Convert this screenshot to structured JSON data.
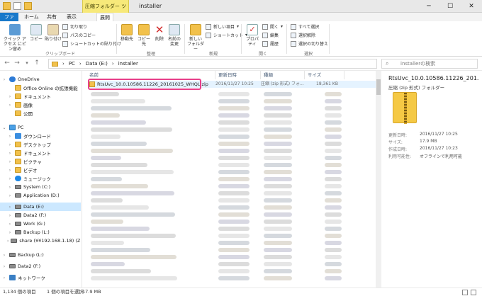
{
  "window": {
    "context_tab": "圧縮フォルダー ツール",
    "title": "installer",
    "minimize": "─",
    "maximize": "☐",
    "close": "✕"
  },
  "ribbon_tabs": [
    "ファイル",
    "ホーム",
    "共有",
    "表示",
    "展開"
  ],
  "ribbon": {
    "pin_label": "クイック アクセス にピン留め",
    "copy_label": "コピー",
    "paste_label": "貼り付け",
    "cut_label": "切り取り",
    "copy_path_label": "パスのコピー",
    "paste_shortcut_label": "ショートカットの貼り付け",
    "clipboard_group": "クリップボード",
    "move_to_label": "移動先",
    "copy_to_label": "コピー先",
    "delete_label": "削除",
    "rename_label": "名前の変更",
    "organize_group": "整理",
    "new_folder_label": "新しい フォルダー",
    "new_item_label": "新しい項目",
    "shortcut_label": "ショートカット",
    "new_group": "新規",
    "properties_label": "プロパティ",
    "open_label": "開く",
    "edit_label": "編集",
    "history_label": "履歴",
    "open_group": "開く",
    "select_all_label": "すべて選択",
    "select_none_label": "選択解除",
    "invert_selection_label": "選択の切り替え",
    "select_group": "選択"
  },
  "address": {
    "breadcrumb": [
      "PC",
      "Data (E:)",
      "installer"
    ],
    "search_placeholder": "installerの検索"
  },
  "nav_items": [
    {
      "label": "OneDrive",
      "icon": "onedrive-icon",
      "level": 0,
      "chev": "›"
    },
    {
      "label": "Office Online の拡張機能",
      "icon": "folder-icon",
      "level": 1,
      "chev": ""
    },
    {
      "label": "ドキュメント",
      "icon": "folder-icon",
      "level": 1,
      "chev": "›"
    },
    {
      "label": "画像",
      "icon": "folder-icon",
      "level": 1,
      "chev": "›"
    },
    {
      "label": "公開",
      "icon": "folder-icon",
      "level": 1,
      "chev": ""
    },
    {
      "label": "PC",
      "icon": "pc-icon",
      "level": 0,
      "chev": "⌄"
    },
    {
      "label": "ダウンロード",
      "icon": "download-icon",
      "level": 1,
      "chev": "›"
    },
    {
      "label": "デスクトップ",
      "icon": "folder-icon",
      "level": 1,
      "chev": "›"
    },
    {
      "label": "ドキュメント",
      "icon": "folder-icon",
      "level": 1,
      "chev": "›"
    },
    {
      "label": "ピクチャ",
      "icon": "folder-icon",
      "level": 1,
      "chev": "›"
    },
    {
      "label": "ビデオ",
      "icon": "folder-icon",
      "level": 1,
      "chev": "›"
    },
    {
      "label": "ミュージック",
      "icon": "music-icon",
      "level": 1,
      "chev": "›"
    },
    {
      "label": "System (C:)",
      "icon": "drive-icon",
      "level": 1,
      "chev": "›"
    },
    {
      "label": "Application (D:)",
      "icon": "drive-icon",
      "level": 1,
      "chev": "›"
    },
    {
      "label": "Data (E:)",
      "icon": "drive-icon",
      "level": 1,
      "chev": "›",
      "selected": true
    },
    {
      "label": "Data2 (F:)",
      "icon": "drive-icon",
      "level": 1,
      "chev": "›"
    },
    {
      "label": "Work (G:)",
      "icon": "drive-icon",
      "level": 1,
      "chev": "›"
    },
    {
      "label": "Backup (L:)",
      "icon": "drive-icon",
      "level": 1,
      "chev": "›"
    },
    {
      "label": "share (¥¥192.168.1.18) (Z:)",
      "icon": "network-drive-icon",
      "level": 1,
      "chev": "›"
    },
    {
      "label": "Backup (L:)",
      "icon": "drive-icon",
      "level": 0,
      "chev": "›"
    },
    {
      "label": "Data2 (F:)",
      "icon": "drive-icon",
      "level": 0,
      "chev": "›"
    },
    {
      "label": "ネットワーク",
      "icon": "network-icon",
      "level": 0,
      "chev": "›"
    }
  ],
  "columns": [
    "名前",
    "更新日時",
    "種類",
    "サイズ"
  ],
  "selected_file": {
    "name": "RtsUvc_10.0.10586.11226_20161025_WHQL.zip",
    "modified": "2016/11/27 10:25",
    "type": "圧縮 (zip 形式) フォ...",
    "size": "18,361 KB"
  },
  "preview": {
    "title": "RtsUvc_10.0.10586.11226_201...",
    "type": "圧縮 (zip 形式) フォルダー",
    "details": [
      {
        "key": "更新日時:",
        "value": "2016/11/27 10:25"
      },
      {
        "key": "サイズ:",
        "value": "17.9 MB"
      },
      {
        "key": "作成日時:",
        "value": "2016/11/27 10:23"
      },
      {
        "key": "利用可能性:",
        "value": "オフラインで利用可能"
      }
    ]
  },
  "status": {
    "item_count": "1,134 個の項目",
    "selection": "1 個の項目を選択",
    "selection_size": "17.9 MB"
  },
  "colors": {
    "accent": "#1979ca",
    "selected_row": "#e5f3ff",
    "nav_selected": "#cce8ff",
    "highlight_border": "#e8408a",
    "context_tab": "#f7e97a"
  }
}
